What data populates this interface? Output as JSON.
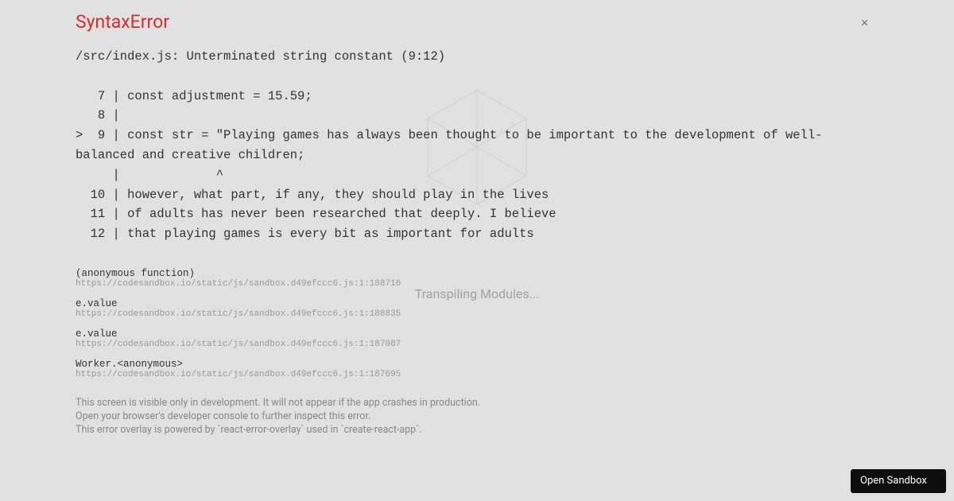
{
  "background": {
    "status": "Transpiling Modules..."
  },
  "error": {
    "title": "SyntaxError",
    "close_label": "×",
    "header_line": "/src/index.js: Unterminated string constant (9:12)",
    "code_lines": [
      "   7 | const adjustment = 15.59;",
      "   8 | ",
      ">  9 | const str = \"Playing games has always been thought to be important to the development of well-balanced and creative children;",
      "     |             ^",
      "  10 | however, what part, if any, they should play in the lives",
      "  11 | of adults has never been researched that deeply. I believe",
      "  12 | that playing games is every bit as important for adults"
    ],
    "stack": [
      {
        "fn": "(anonymous function)",
        "loc": "https://codesandbox.io/static/js/sandbox.d49efccc6.js:1:188716"
      },
      {
        "fn": "e.value",
        "loc": "https://codesandbox.io/static/js/sandbox.d49efccc6.js:1:188835"
      },
      {
        "fn": "e.value",
        "loc": "https://codesandbox.io/static/js/sandbox.d49efccc6.js:1:187087"
      },
      {
        "fn": "Worker.<anonymous>",
        "loc": "https://codesandbox.io/static/js/sandbox.d49efccc6.js:1:187695"
      }
    ],
    "footer": [
      "This screen is visible only in development. It will not appear if the app crashes in production.",
      "Open your browser's developer console to further inspect this error.",
      "This error overlay is powered by `react-error-overlay` used in `create-react-app`."
    ]
  },
  "open_sandbox": {
    "label": "Open Sandbox"
  }
}
